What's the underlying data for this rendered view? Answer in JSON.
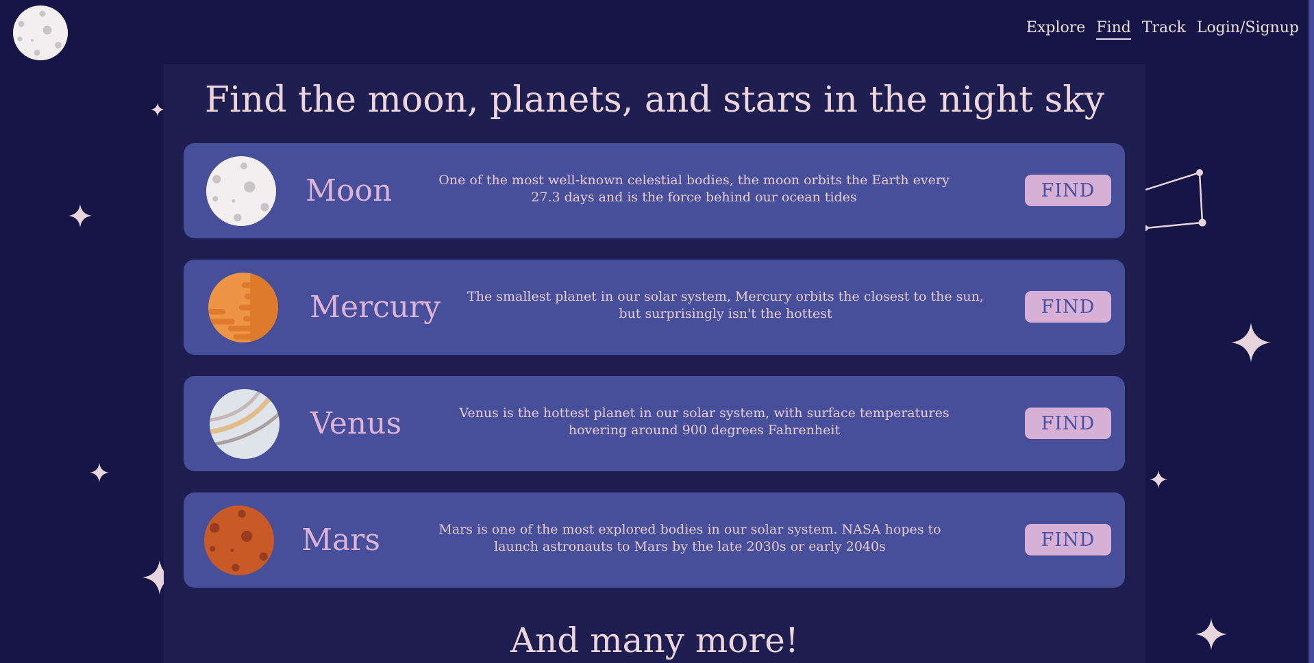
{
  "header": {
    "logo_icon": "moon-icon",
    "nav": [
      {
        "label": "Explore",
        "active": false
      },
      {
        "label": "Find",
        "active": true
      },
      {
        "label": "Track",
        "active": false
      },
      {
        "label": "Login/Signup",
        "active": false
      }
    ]
  },
  "main": {
    "title": "Find the moon, planets, and stars in the night sky",
    "cards": [
      {
        "name": "Moon",
        "icon": "moon-icon",
        "description": "One of the most well-known celestial bodies, the moon orbits the Earth every 27.3 days and is the force behind our ocean tides",
        "button": "FIND"
      },
      {
        "name": "Mercury",
        "icon": "mercury-icon",
        "description": "The smallest planet in our solar system, Mercury orbits the closest to the sun, but surprisingly isn't the hottest",
        "button": "FIND"
      },
      {
        "name": "Venus",
        "icon": "venus-icon",
        "description": "Venus is the hottest planet in our solar system, with surface temperatures hovering around 900 degrees Fahrenheit",
        "button": "FIND"
      },
      {
        "name": "Mars",
        "icon": "mars-icon",
        "description": "Mars is one of the most explored bodies in our solar system. NASA hopes to launch astronauts to Mars by the late 2030s or early 2040s",
        "button": "FIND"
      }
    ],
    "more_heading": "And many more!"
  },
  "colors": {
    "background": "#161646",
    "panel": "#1f1e50",
    "card": "#474e9a",
    "button": "#d6b0d6",
    "button_text": "#48529e",
    "text": "#ecd5dc",
    "star": "#e8d4dc"
  }
}
